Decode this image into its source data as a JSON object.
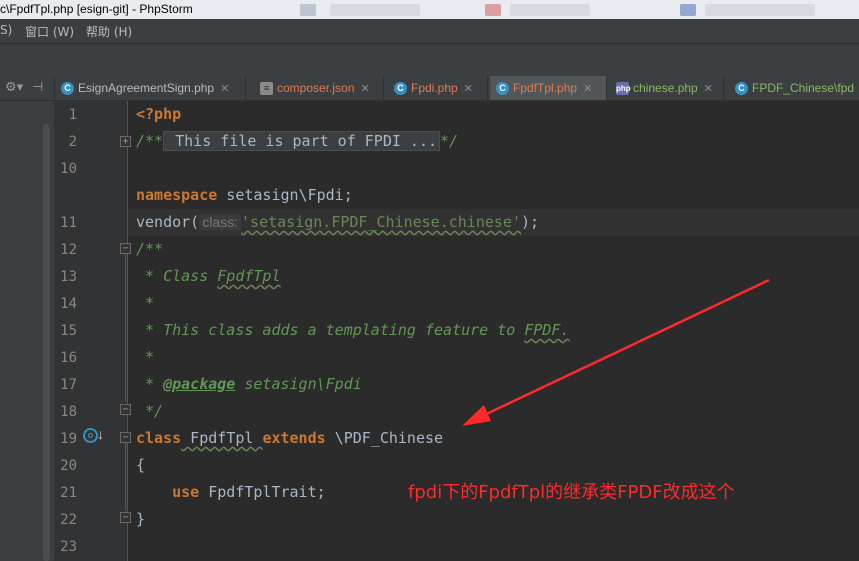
{
  "window": {
    "title": "c\\FpdfTpl.php [esign-git] - PhpStorm"
  },
  "menu": {
    "items": [
      "S)",
      "窗口 (W)",
      "帮助 (H)"
    ]
  },
  "tabs": [
    {
      "label": "EsignAgreementSign.php",
      "icon": "php-class-icon",
      "color": "#bbbbbb",
      "active": false
    },
    {
      "label": "composer.json",
      "icon": "json-file-icon",
      "color": "#e07b53",
      "active": false
    },
    {
      "label": "Fpdi.php",
      "icon": "php-class-icon",
      "color": "#e07b53",
      "active": false
    },
    {
      "label": "FpdfTpl.php",
      "icon": "php-class-icon",
      "color": "#e07b53",
      "active": true
    },
    {
      "label": "chinese.php",
      "icon": "php-file-icon",
      "color": "#8db861",
      "active": false
    },
    {
      "label": "FPDF_Chinese\\fpd",
      "icon": "php-class-icon",
      "color": "#8db861",
      "active": false
    }
  ],
  "editor": {
    "line_numbers": [
      "1",
      "2",
      "10",
      "11",
      "12",
      "13",
      "14",
      "15",
      "16",
      "17",
      "18",
      "19",
      "20",
      "21",
      "22",
      "23"
    ],
    "php_open": "<?php",
    "line2_start": "/**",
    "line2_folded": " This file is part of FPDI ...",
    "line2_end": "*/",
    "ns_kw": "namespace",
    "ns_value": " setasign\\Fpdi;",
    "vendor_call": "vendor(",
    "vendor_hint": "class:",
    "vendor_string": "'setasign.FPDF_Chinese.chinese'",
    "vendor_end": ");",
    "doc_open": "/**",
    "doc_class_prefix": " * Class ",
    "doc_class_name": "FpdfTpl",
    "doc_star": " *",
    "doc_desc_prefix": " * This class adds a templating feature to ",
    "doc_desc_fpdf": "FPDF.",
    "doc_pkg_prefix": " * ",
    "doc_pkg_tag": "@package",
    "doc_pkg_value": " setasign\\Fpdi",
    "doc_close": " */",
    "class_kw": "class",
    "class_name": " FpdfTpl ",
    "extends_kw": "extends",
    "parent": " \\PDF_Chinese",
    "brace_open": "{",
    "use_kw": "    use",
    "use_value": " FpdfTplTrait;",
    "brace_close": "}"
  },
  "annotation": {
    "text": "fpdi下的FpdfTpl的继承类FPDF改成这个",
    "color": "#ff2a2a"
  },
  "colors": {
    "keyword": "#cc7832",
    "comment": "#629755",
    "string": "#6a8759",
    "background": "#2b2b2b"
  }
}
